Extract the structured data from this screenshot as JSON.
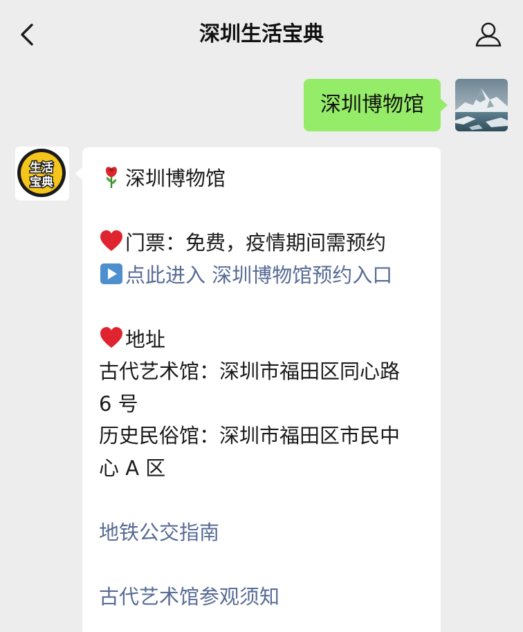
{
  "header": {
    "title": "深圳生活宝典"
  },
  "sent": {
    "text": "深圳博物馆"
  },
  "reply": {
    "heading": "深圳博物馆",
    "ticket": "门票：免费，疫情期间需预约",
    "booking_link": "点此进入 深圳博物馆预约入口",
    "address_heading": "地址",
    "ancient_hall_1": "古代艺术馆：深圳市福田区同心路",
    "ancient_hall_2": "6 号",
    "folk_hall_1": "历史民俗馆：深圳市福田区市民中",
    "folk_hall_2": "心 A 区",
    "transit_link": "地铁公交指南",
    "visit_notice_link": "古代艺术馆参观须知"
  },
  "bot_avatar": {
    "text_top": "生活",
    "text_bottom": "宝典"
  },
  "icons": {
    "back": "chevron-left-icon",
    "profile": "person-icon",
    "rose": "rose-icon",
    "heart": "heart-icon",
    "play": "play-button-icon"
  },
  "colors": {
    "background": "#ededed",
    "sent_bubble": "#95ec69",
    "received_bubble": "#ffffff",
    "link": "#576b95",
    "heart": "#e0242f"
  }
}
